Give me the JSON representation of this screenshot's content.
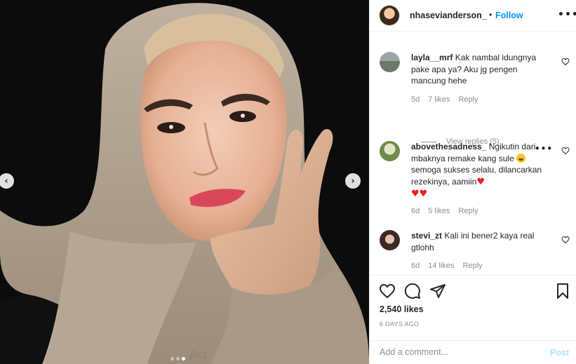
{
  "post": {
    "username": "nhasevianderson_",
    "bullet": "•",
    "follow_label": "Follow",
    "more_icon": "•••",
    "likes": "2,540 likes",
    "time_ago": "6 DAYS AGO"
  },
  "carousel": {
    "prev_icon": "‹",
    "next_icon": "›",
    "slide_count": 3,
    "active_slide": 3
  },
  "comments": [
    {
      "username": "layla__mrf",
      "text": "Kak nambal idungnya pake apa ya? Aku jg pengen mancung hehe",
      "age": "5d",
      "likes": "7 likes",
      "reply": "Reply"
    },
    {
      "username": "abovethesadness_",
      "text_a": "Ngikutin dari mbaknya remake kang sule",
      "text_b": "semoga sukses selalu, dilancarkan rezekinya, aamiin",
      "age": "6d",
      "likes": "5 likes",
      "reply": "Reply",
      "more_icon": "•••"
    },
    {
      "username": "stevi_zt",
      "text": "Kali ini bener2 kaya real gtlohh",
      "age": "6d",
      "likes": "14 likes",
      "reply": "Reply"
    }
  ],
  "view_replies": "View replies (5)",
  "add_comment": {
    "placeholder": "Add a comment...",
    "post_label": "Post"
  },
  "watermark": "Act",
  "icons": [
    "heart-icon",
    "comment-icon",
    "share-icon",
    "bookmark-icon",
    "chevron-left-icon",
    "chevron-right-icon",
    "more-icon"
  ],
  "colors": {
    "accent": "#0095f6",
    "post_disabled": "#b2dffc",
    "muted": "#8e8e8e",
    "heart_emoji": "#ed1c24"
  }
}
